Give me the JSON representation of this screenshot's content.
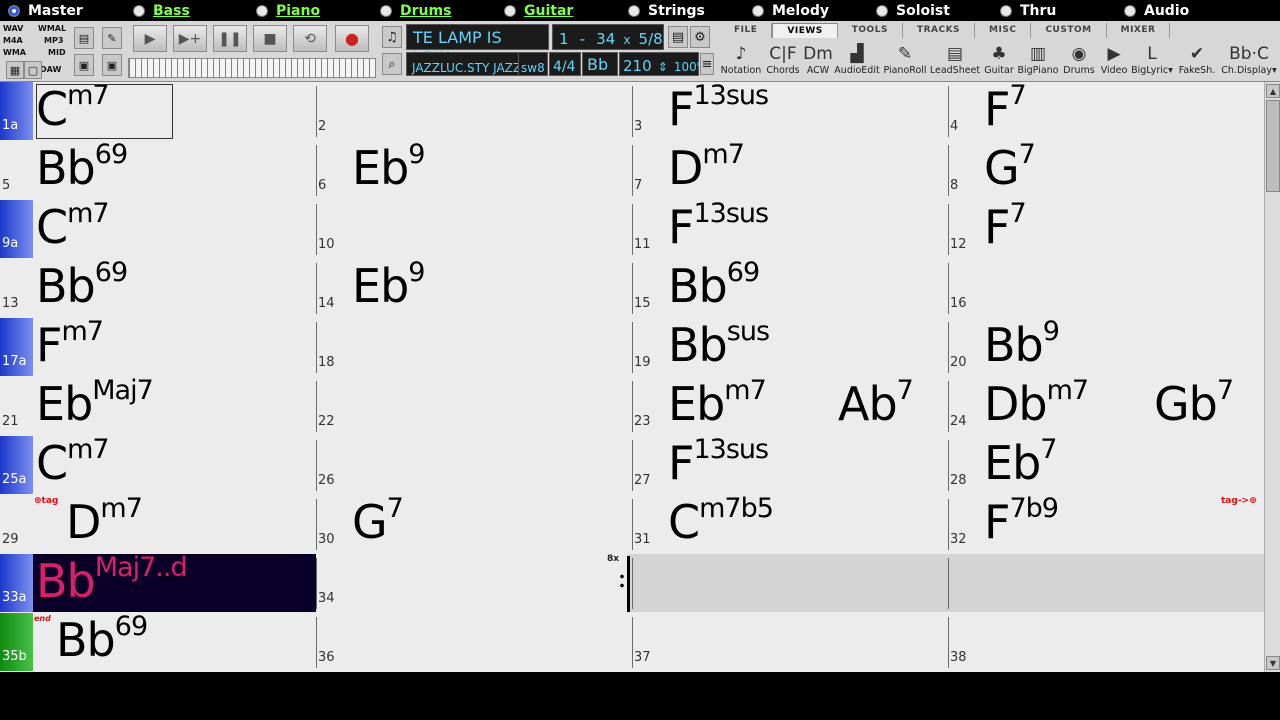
{
  "tracks": [
    {
      "label": "Master",
      "selected": true,
      "active": false
    },
    {
      "label": "Bass",
      "selected": false,
      "active": true
    },
    {
      "label": "Piano",
      "selected": false,
      "active": true
    },
    {
      "label": "Drums",
      "selected": false,
      "active": true
    },
    {
      "label": "Guitar",
      "selected": false,
      "active": true
    },
    {
      "label": "Strings",
      "selected": false,
      "active": false
    },
    {
      "label": "Melody",
      "selected": false,
      "active": false
    },
    {
      "label": "Soloist",
      "selected": false,
      "active": false
    },
    {
      "label": "Thru",
      "selected": false,
      "active": false
    },
    {
      "label": "Audio",
      "selected": false,
      "active": false
    }
  ],
  "formats": {
    "wav": "WAV",
    "wmal": "WMAL",
    "m4a": "M4A",
    "mp3": "MP3",
    "wma": "WMA",
    "mid": "MID",
    "daw": "DAW"
  },
  "transport": {
    "play": "▶",
    "play_from": "▶+",
    "pause": "❚❚",
    "stop": "■",
    "loop": "⟲",
    "record": "●"
  },
  "song": {
    "title": "TE LAMP IS LOW",
    "start_bar": "1",
    "dash": "-",
    "end_bar": "34",
    "times": "x",
    "repeats": "5/8",
    "style": "JAZZLUC.STY JAZZ",
    "feel": "sw8",
    "time_sig": "4/4",
    "key": "Bb",
    "tempo": "210",
    "zoom": "100%"
  },
  "menu_tabs": [
    "FILE",
    "VIEWS",
    "TOOLS",
    "TRACKS",
    "MISC",
    "CUSTOM",
    "MIXER"
  ],
  "active_tab": "VIEWS",
  "view_buttons": [
    {
      "label": "Notation",
      "icon": "♪"
    },
    {
      "label": "Chords",
      "icon": "C|F"
    },
    {
      "label": "ACW",
      "icon": "Dm"
    },
    {
      "label": "AudioEdit",
      "icon": "▟"
    },
    {
      "label": "PianoRoll",
      "icon": "✎"
    },
    {
      "label": "LeadSheet",
      "icon": "▤"
    },
    {
      "label": "Guitar",
      "icon": "♣"
    },
    {
      "label": "BigPiano",
      "icon": "▥"
    },
    {
      "label": "Drums",
      "icon": "◉"
    },
    {
      "label": "Video",
      "icon": "▶"
    },
    {
      "label": "BigLyric▾",
      "icon": "L"
    },
    {
      "label": "FakeSh.",
      "icon": "✔"
    },
    {
      "label": "Ch.Display▾",
      "icon": "Bb·C"
    }
  ],
  "rows": [
    {
      "part": "1a",
      "part_color": "blue",
      "bars": [
        {
          "num": "",
          "chords": [
            {
              "root": "C",
              "ext": "m7"
            }
          ]
        },
        {
          "num": "2",
          "chords": []
        },
        {
          "num": "3",
          "chords": [
            {
              "root": "F",
              "ext": "13sus"
            }
          ]
        },
        {
          "num": "4",
          "chords": [
            {
              "root": "F",
              "ext": "7"
            }
          ]
        }
      ]
    },
    {
      "part": "",
      "part_color": "",
      "bars": [
        {
          "num": "5",
          "chords": [
            {
              "root": "Bb",
              "ext": "69"
            }
          ]
        },
        {
          "num": "6",
          "chords": [
            {
              "root": "Eb",
              "ext": "9"
            }
          ]
        },
        {
          "num": "7",
          "chords": [
            {
              "root": "D",
              "ext": "m7"
            }
          ]
        },
        {
          "num": "8",
          "chords": [
            {
              "root": "G",
              "ext": "7"
            }
          ]
        }
      ]
    },
    {
      "part": "9a",
      "part_color": "blue",
      "bars": [
        {
          "num": "",
          "chords": [
            {
              "root": "C",
              "ext": "m7"
            }
          ]
        },
        {
          "num": "10",
          "chords": []
        },
        {
          "num": "11",
          "chords": [
            {
              "root": "F",
              "ext": "13sus"
            }
          ]
        },
        {
          "num": "12",
          "chords": [
            {
              "root": "F",
              "ext": "7"
            }
          ]
        }
      ]
    },
    {
      "part": "",
      "part_color": "",
      "bars": [
        {
          "num": "13",
          "chords": [
            {
              "root": "Bb",
              "ext": "69"
            }
          ]
        },
        {
          "num": "14",
          "chords": [
            {
              "root": "Eb",
              "ext": "9"
            }
          ]
        },
        {
          "num": "15",
          "chords": [
            {
              "root": "Bb",
              "ext": "69"
            }
          ]
        },
        {
          "num": "16",
          "chords": []
        }
      ]
    },
    {
      "part": "17a",
      "part_color": "blue",
      "bars": [
        {
          "num": "",
          "chords": [
            {
              "root": "F",
              "ext": "m7"
            }
          ]
        },
        {
          "num": "18",
          "chords": []
        },
        {
          "num": "19",
          "chords": [
            {
              "root": "Bb",
              "ext": "sus"
            }
          ]
        },
        {
          "num": "20",
          "chords": [
            {
              "root": "Bb",
              "ext": "9"
            }
          ]
        }
      ]
    },
    {
      "part": "",
      "part_color": "",
      "bars": [
        {
          "num": "21",
          "chords": [
            {
              "root": "Eb",
              "ext": "Maj7"
            }
          ]
        },
        {
          "num": "22",
          "chords": []
        },
        {
          "num": "23",
          "chords": [
            {
              "root": "Eb",
              "ext": "m7"
            },
            {
              "root": "Ab",
              "ext": "7"
            }
          ]
        },
        {
          "num": "24",
          "chords": [
            {
              "root": "Db",
              "ext": "m7"
            },
            {
              "root": "Gb",
              "ext": "7"
            }
          ]
        }
      ]
    },
    {
      "part": "25a",
      "part_color": "blue",
      "bars": [
        {
          "num": "",
          "chords": [
            {
              "root": "C",
              "ext": "m7"
            }
          ]
        },
        {
          "num": "26",
          "chords": []
        },
        {
          "num": "27",
          "chords": [
            {
              "root": "F",
              "ext": "13sus"
            }
          ]
        },
        {
          "num": "28",
          "chords": [
            {
              "root": "Eb",
              "ext": "7"
            }
          ]
        }
      ]
    },
    {
      "part": "",
      "part_color": "",
      "bars": [
        {
          "num": "29",
          "chords": [
            {
              "root": "D",
              "ext": "m7"
            }
          ]
        },
        {
          "num": "30",
          "chords": [
            {
              "root": "G",
              "ext": "7"
            }
          ]
        },
        {
          "num": "31",
          "chords": [
            {
              "root": "C",
              "ext": "m7b5"
            }
          ]
        },
        {
          "num": "32",
          "chords": [
            {
              "root": "F",
              "ext": "7b9"
            }
          ]
        }
      ]
    },
    {
      "part": "33a",
      "part_color": "blue",
      "bars": [
        {
          "num": "",
          "chords": [
            {
              "root": "Bb",
              "ext": "Maj7..d"
            }
          ]
        },
        {
          "num": "34",
          "chords": []
        },
        {
          "num": "",
          "chords": []
        },
        {
          "num": "",
          "chords": []
        }
      ]
    },
    {
      "part": "35b",
      "part_color": "green",
      "bars": [
        {
          "num": "",
          "chords": [
            {
              "root": "Bb",
              "ext": "69"
            }
          ]
        },
        {
          "num": "36",
          "chords": []
        },
        {
          "num": "37",
          "chords": []
        },
        {
          "num": "38",
          "chords": []
        }
      ]
    }
  ],
  "markers": {
    "tag_start": "⊕tag",
    "tag_end": "tag->⊕",
    "end": "end",
    "repeat": "8x"
  }
}
